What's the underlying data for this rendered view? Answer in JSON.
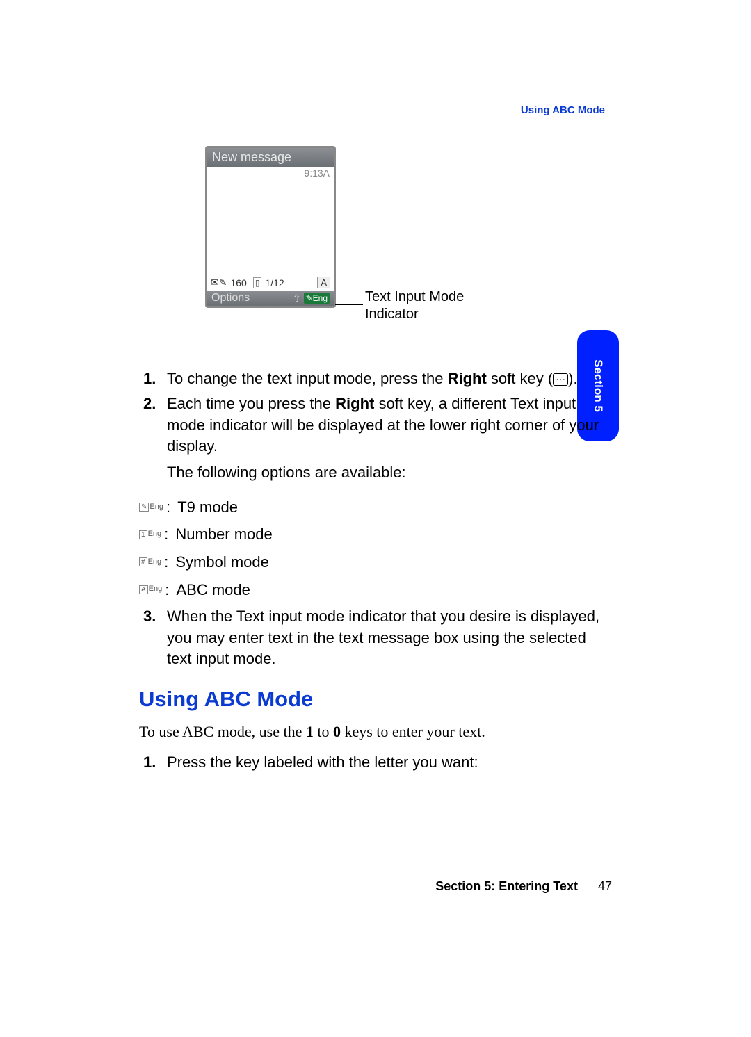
{
  "header": {
    "running_title": "Using ABC Mode"
  },
  "phone": {
    "title": "New message",
    "time": "9:13A",
    "char_count": "160",
    "page_indicator": "1/12",
    "mode_letter": "A",
    "left_softkey": "Options",
    "right_softkey_badge": "Eng"
  },
  "callout": {
    "line1": "Text Input Mode",
    "line2": "Indicator"
  },
  "steps_a": {
    "1_pre": "To change the text input mode, press the ",
    "1_bold": "Right",
    "1_post": " soft key (",
    "1_end": ").",
    "2_pre": "Each time you press the ",
    "2_bold": "Right",
    "2_post": " soft key, a different Text input mode indicator will be displayed at the lower right corner of your display.",
    "following": "The following options are available:"
  },
  "modes": {
    "t9": "T9 mode",
    "number": "Number mode",
    "symbol": "Symbol mode",
    "abc": "ABC mode"
  },
  "step3": "When the Text input mode indicator that you desire is displayed, you may enter text in the text message box using the selected text input mode.",
  "section": {
    "heading": "Using ABC Mode",
    "intro_pre": "To use ABC mode, use the ",
    "intro_b1": "1",
    "intro_mid": " to ",
    "intro_b2": "0",
    "intro_post": " keys to enter your text.",
    "step1": "Press the key labeled with the letter you want:"
  },
  "tab": {
    "label": "Section 5"
  },
  "footer": {
    "section": "Section 5: Entering Text",
    "page": "47"
  }
}
